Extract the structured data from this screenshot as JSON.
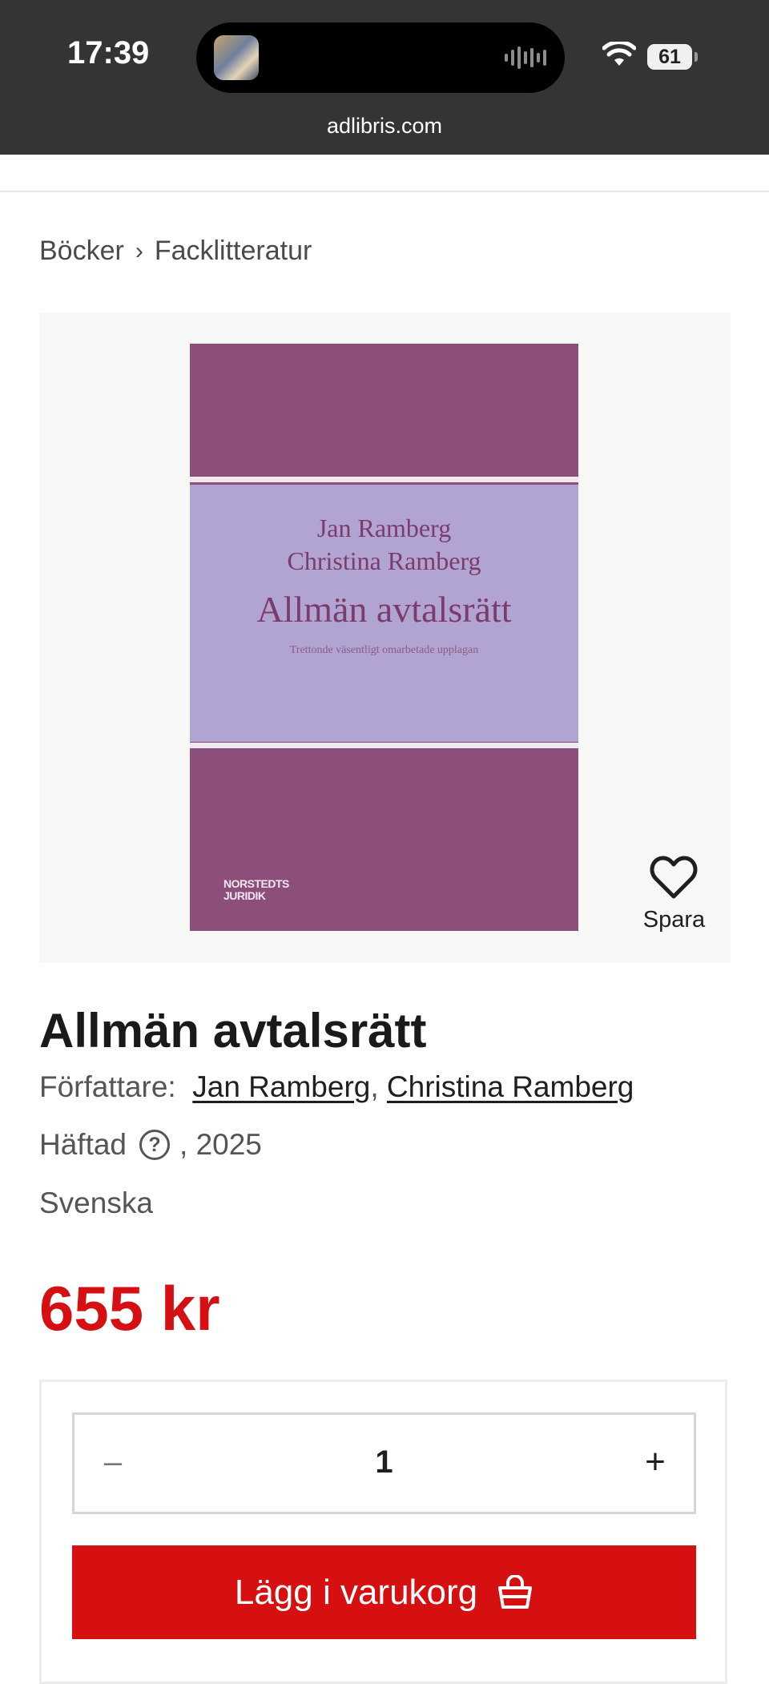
{
  "status_bar": {
    "time": "17:39",
    "battery": "61",
    "url": "adlibris.com",
    "icons": [
      "now-playing-thumbnail",
      "audio-wave-icon",
      "wifi-icon",
      "battery-icon"
    ]
  },
  "breadcrumb": {
    "items": [
      "Böcker",
      "Facklitteratur"
    ],
    "separator": "›"
  },
  "product": {
    "cover": {
      "authors_line1": "Jan Ramberg",
      "authors_line2": "Christina Ramberg",
      "title": "Allmän avtalsrätt",
      "subtitle": "Trettonde väsentligt omarbetade upplagan",
      "publisher_line1": "NORSTEDTS",
      "publisher_line2": "JURIDIK",
      "colors": {
        "frame": "#8b4f7a",
        "panel": "#b2a4d2",
        "text": "#7b3c6b"
      }
    },
    "save_label": "Spara",
    "title": "Allmän avtalsrätt",
    "authors_label": "Författare:",
    "authors": [
      "Jan Ramberg",
      "Christina Ramberg"
    ],
    "author_separator": ",",
    "format": "Häftad",
    "help_symbol": "?",
    "year": ", 2025",
    "language": "Svenska",
    "price": "655 kr"
  },
  "purchase": {
    "minus": "–",
    "quantity": "1",
    "plus": "+",
    "add_to_cart_label": "Lägg i varukorg"
  },
  "colors": {
    "accent": "#d60f10",
    "price": "#d50f12",
    "status_bar": "#333435"
  }
}
